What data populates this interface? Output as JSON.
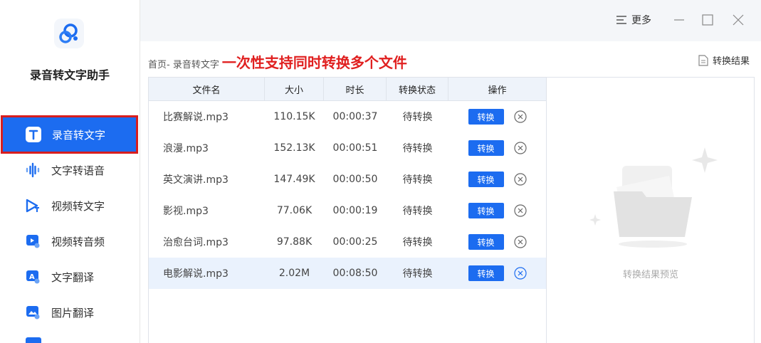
{
  "app": {
    "name": "录音转文字助手"
  },
  "sidebar": {
    "items": [
      {
        "label": "录音转文字",
        "icon": "text-t-icon",
        "active": true
      },
      {
        "label": "文字转语音",
        "icon": "waveform-icon"
      },
      {
        "label": "视频转文字",
        "icon": "video-text-icon"
      },
      {
        "label": "视频转音频",
        "icon": "video-audio-icon"
      },
      {
        "label": "文字翻译",
        "icon": "translate-icon"
      },
      {
        "label": "图片翻译",
        "icon": "image-translate-icon"
      }
    ]
  },
  "topbar": {
    "more_label": "更多"
  },
  "breadcrumb": {
    "path": "首页- 录音转文字",
    "slogan": "一次性支持同时转换多个文件"
  },
  "result_link": "转换结果",
  "table": {
    "headers": [
      "文件名",
      "大小",
      "时长",
      "转换状态",
      "操作"
    ],
    "action_label": "转换",
    "rows": [
      {
        "name": "比赛解说.mp3",
        "size": "110.15K",
        "duration": "00:00:37",
        "status": "待转换"
      },
      {
        "name": "浪漫.mp3",
        "size": "152.13K",
        "duration": "00:00:51",
        "status": "待转换"
      },
      {
        "name": "英文演讲.mp3",
        "size": "147.49K",
        "duration": "00:00:50",
        "status": "待转换"
      },
      {
        "name": "影视.mp3",
        "size": "77.06K",
        "duration": "00:00:19",
        "status": "待转换"
      },
      {
        "name": "治愈台词.mp3",
        "size": "97.88K",
        "duration": "00:00:25",
        "status": "待转换"
      },
      {
        "name": "电影解说.mp3",
        "size": "2.02M",
        "duration": "00:08:50",
        "status": "待转换",
        "highlight": true
      }
    ]
  },
  "preview": {
    "placeholder": "转换结果预览"
  },
  "colors": {
    "accent": "#1c6cf0",
    "highlight_border": "#d81e1e",
    "slogan": "#e02020"
  }
}
